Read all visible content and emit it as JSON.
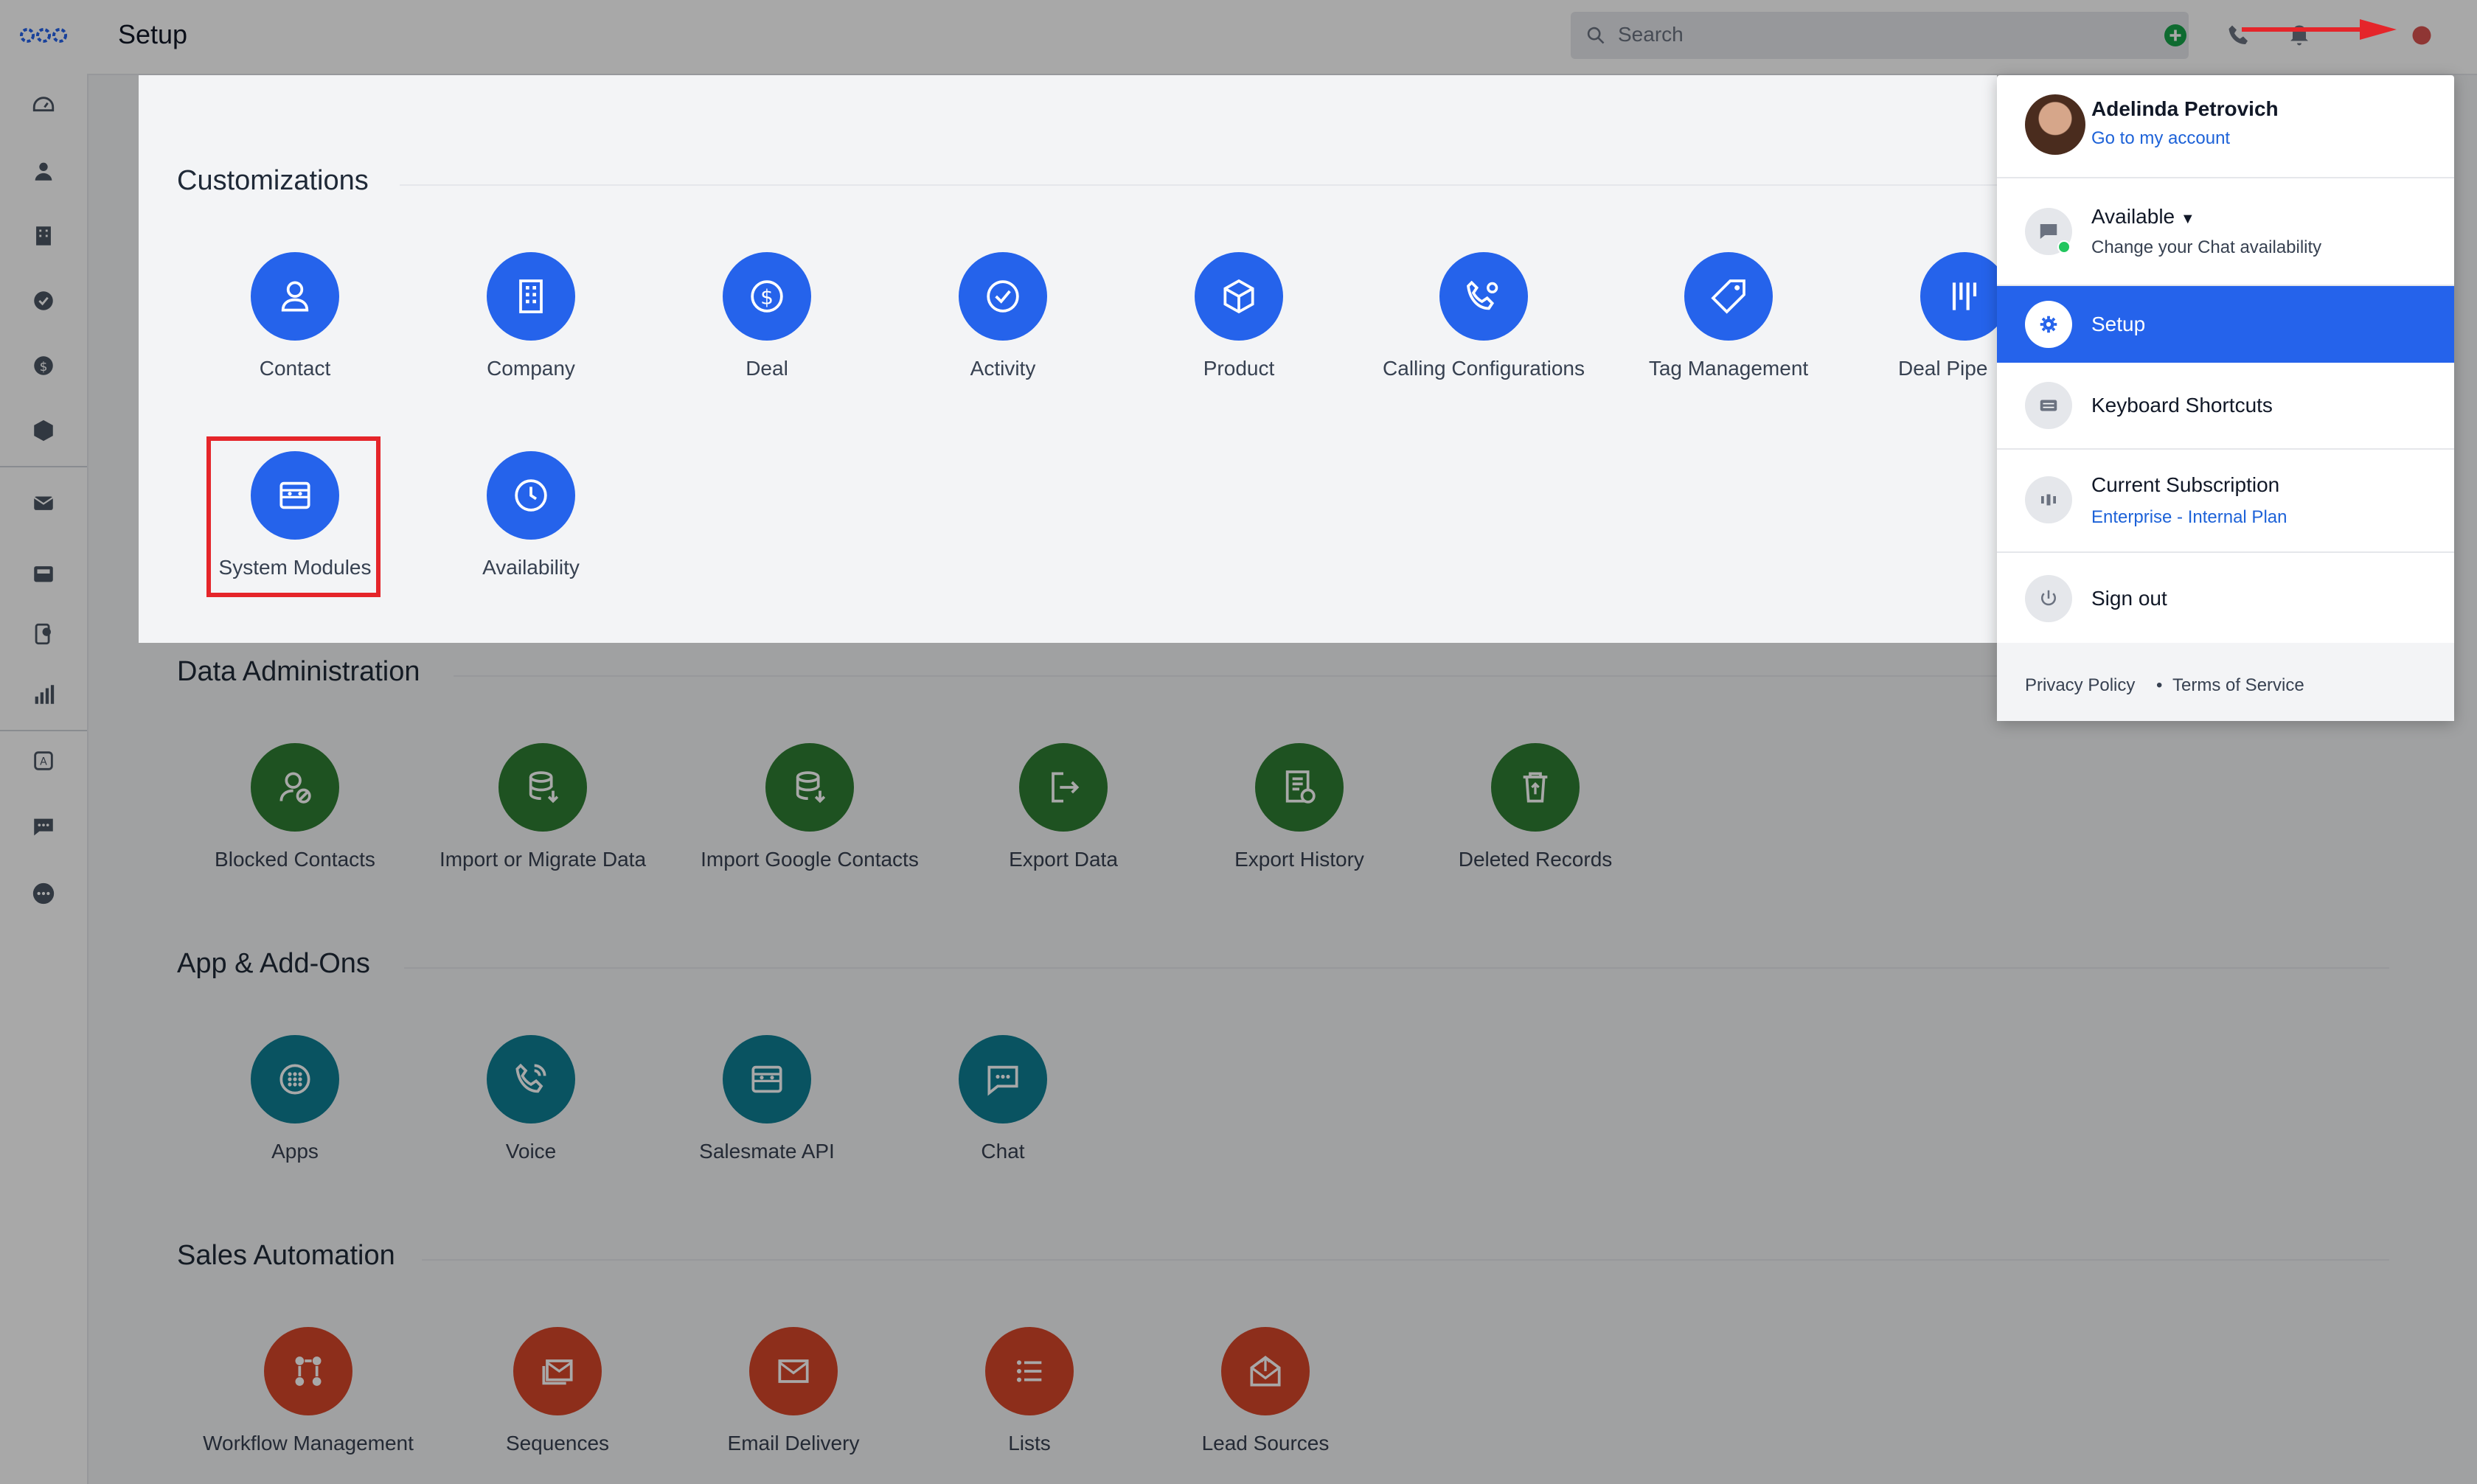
{
  "topbar": {
    "title": "Setup",
    "search_placeholder": "Search"
  },
  "sections": {
    "customizations": {
      "title": "Customizations",
      "tiles": [
        "Contact",
        "Company",
        "Deal",
        "Activity",
        "Product",
        "Calling Configurations",
        "Tag Management",
        "Deal Pipe",
        "System Modules",
        "Availability"
      ]
    },
    "data_admin": {
      "title": "Data Administration",
      "tiles": [
        "Blocked Contacts",
        "Import or Migrate Data",
        "Import Google Contacts",
        "Export Data",
        "Export History",
        "Deleted Records"
      ]
    },
    "apps": {
      "title": "App & Add-Ons",
      "tiles": [
        "Apps",
        "Voice",
        "Salesmate API",
        "Chat"
      ]
    },
    "automation": {
      "title": "Sales Automation",
      "tiles": [
        "Workflow Management",
        "Sequences",
        "Email Delivery",
        "Lists",
        "Lead Sources"
      ]
    }
  },
  "menu": {
    "user_name": "Adelinda Petrovich",
    "account_link": "Go to my account",
    "availability": "Available",
    "availability_sub": "Change your Chat availability",
    "setup": "Setup",
    "shortcuts": "Keyboard Shortcuts",
    "subscription": "Current Subscription",
    "plan": "Enterprise - Internal Plan",
    "signout": "Sign out",
    "privacy": "Privacy Policy",
    "dot": "•",
    "terms": "Terms of Service"
  },
  "colors": {
    "primary_blue": "#2563eb",
    "green": "#2e7d32",
    "teal": "#0f7f94",
    "red": "#d7462a",
    "highlight": "#e5252a"
  }
}
